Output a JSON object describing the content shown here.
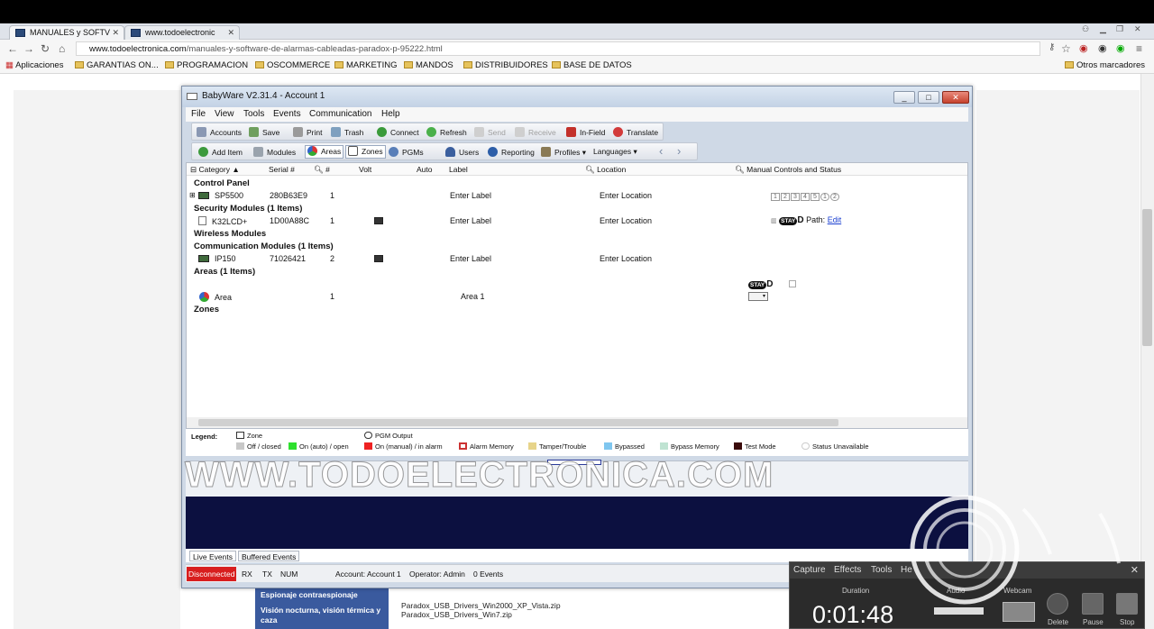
{
  "browser": {
    "tabs": [
      "MANUALES y SOFTV",
      "www.todoelectronic"
    ],
    "url_domain": "www.todoelectronica.com",
    "url_path": "/manuales-y-software-de-alarmas-cableadas-paradox-p-95222.html",
    "bookmarks": [
      "Aplicaciones",
      "GARANTIAS ON...",
      "PROGRAMACION",
      "OSCOMMERCE",
      "MARKETING",
      "MANDOS",
      "DISTRIBUIDORES",
      "BASE DE DATOS"
    ],
    "other_bookmarks": "Otros marcadores"
  },
  "app": {
    "title": "BabyWare V2.31.4 - Account 1",
    "menu": [
      "File",
      "View",
      "Tools",
      "Events",
      "Communication",
      "Help"
    ],
    "toolbar1": {
      "accounts": "Accounts",
      "save": "Save",
      "print": "Print",
      "trash": "Trash",
      "connect": "Connect",
      "refresh": "Refresh",
      "send": "Send",
      "receive": "Receive",
      "infield": "In-Field",
      "translate": "Translate"
    },
    "toolbar2": {
      "add_item": "Add Item",
      "modules": "Modules",
      "areas": "Areas",
      "zones": "Zones",
      "pgms": "PGMs",
      "users": "Users",
      "reporting": "Reporting",
      "profiles": "Profiles",
      "languages": "Languages"
    },
    "grid": {
      "headers": [
        "Category",
        "Serial #",
        "#",
        "Volt",
        "Auto",
        "Label",
        "Location",
        "Manual Controls and Status"
      ],
      "sections": {
        "control_panel": "Control Panel",
        "security": "Security Modules (1 Items)",
        "wireless": "Wireless Modules",
        "communication": "Communication Modules (1 Items)",
        "areas": "Areas (1 Items)",
        "zones": "Zones"
      },
      "rows": {
        "sp5500": {
          "category": "SP5500",
          "serial": "280B63E9",
          "num": "1",
          "label": "Enter Label",
          "location": "Enter Location"
        },
        "k32": {
          "category": "K32LCD+",
          "serial": "1D00A88C",
          "num": "1",
          "label": "Enter Label",
          "location": "Enter Location"
        },
        "ip150": {
          "category": "IP150",
          "serial": "71026421",
          "num": "2",
          "label": "Enter Label",
          "location": "Enter Location"
        },
        "area": {
          "category": "Area",
          "num": "1",
          "label": "Area 1"
        }
      },
      "panel_numbers": [
        "1",
        "2",
        "3",
        "4",
        "5",
        "1",
        "2"
      ],
      "stay": "STAY",
      "stay_letter": "D",
      "path_label": "Path:",
      "path_link": "Edit"
    },
    "legend": {
      "title": "Legend:",
      "items": [
        "Zone",
        "PGM Output",
        "Off / closed",
        "On (auto) / open",
        "On (manual) / in alarm",
        "Alarm Memory",
        "Tamper/Trouble",
        "Bypassed",
        "Bypass Memory",
        "Test Mode",
        "Status Unavailable"
      ]
    },
    "events": {
      "live": "Live Events",
      "buffered": "Buffered Events"
    },
    "status": {
      "connection": "Disconnected",
      "rx": "RX",
      "tx": "TX",
      "num": "NUM",
      "account": "Account: Account 1",
      "operator": "Operator: Admin",
      "events": "0 Events"
    }
  },
  "page_bg": {
    "sidebar_items": [
      "Espionaje contraespionaje",
      "Visión nocturna, visión térmica y caza"
    ],
    "files": [
      "Paradox_USB_Drivers_Win2000_XP_Vista.zip",
      "Paradox_USB_Drivers_Win7.zip"
    ]
  },
  "watermark": "WWW.TODOELECTRONICA.COM",
  "recorder": {
    "menu": [
      "Capture",
      "Effects",
      "Tools",
      "He"
    ],
    "duration_label": "Duration",
    "audio_label": "Audio",
    "webcam_label": "Webcam",
    "timer": "0:01:48",
    "buttons": [
      "Delete",
      "Pause",
      "Stop"
    ]
  }
}
